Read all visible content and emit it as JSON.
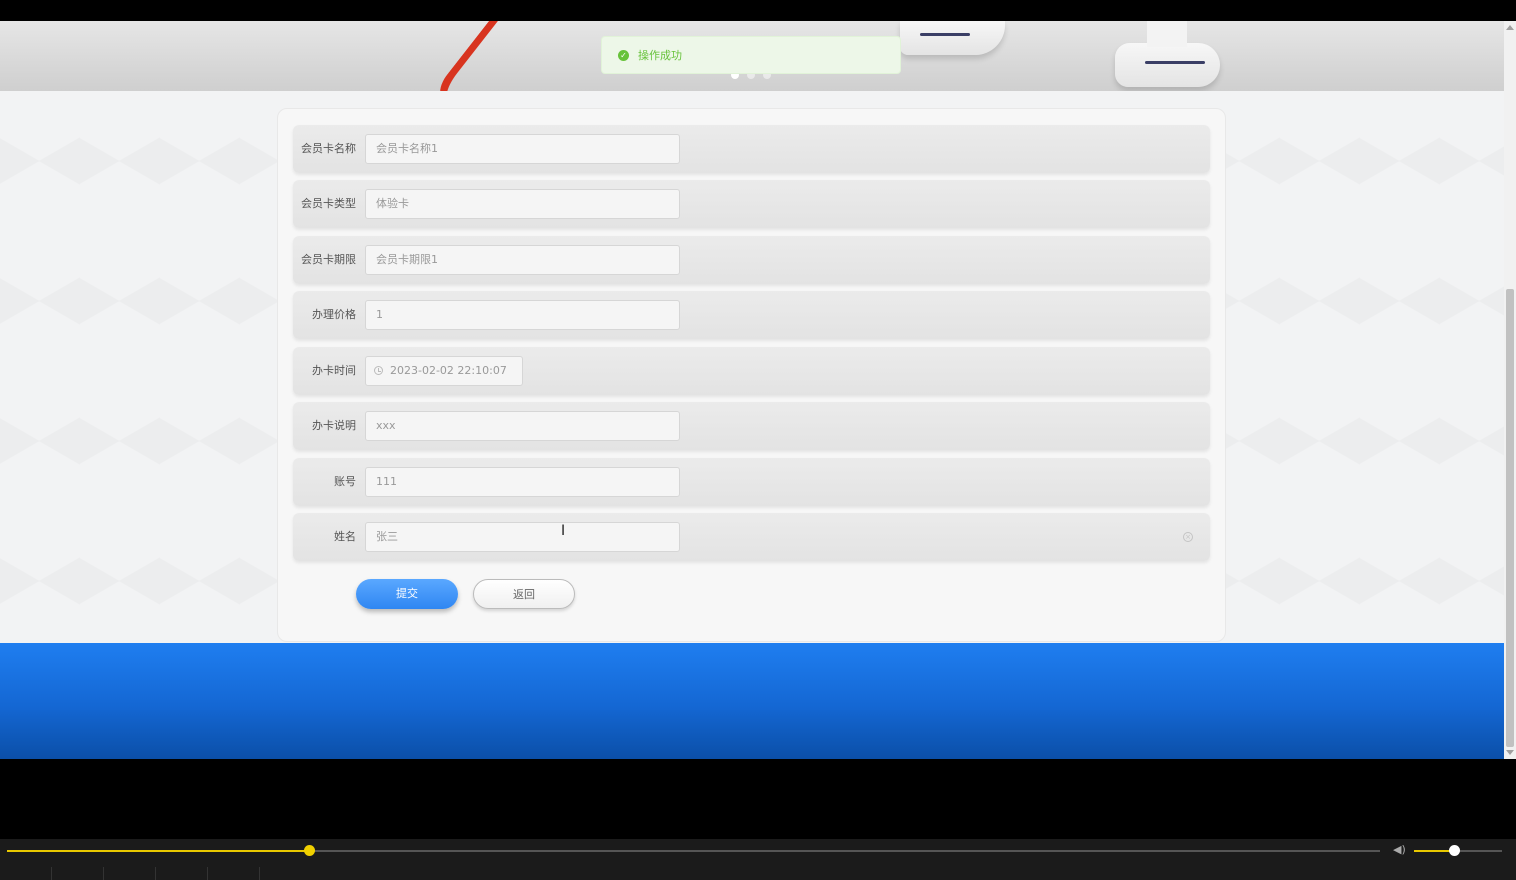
{
  "toast": {
    "message": "操作成功",
    "icon": "check-circle-icon",
    "color": "#67c23a"
  },
  "carousel": {
    "slides": 3,
    "active_index": 0
  },
  "form": {
    "fields": [
      {
        "label": "会员卡名称",
        "value": "会员卡名称1"
      },
      {
        "label": "会员卡类型",
        "value": "体验卡"
      },
      {
        "label": "会员卡期限",
        "value": "会员卡期限1"
      },
      {
        "label": "办理价格",
        "value": "1"
      },
      {
        "label": "办卡时间",
        "value": "2023-02-02 22:10:07"
      },
      {
        "label": "办卡说明",
        "value": "xxx"
      },
      {
        "label": "账号",
        "value": "111"
      },
      {
        "label": "姓名",
        "value": "张三"
      }
    ],
    "submit_label": "提交",
    "back_label": "返回"
  },
  "colors": {
    "primary": "#2f86f2",
    "footer": "#1467d3",
    "progress": "#e8c800"
  },
  "player": {
    "progress_fraction": 0.22,
    "volume_fraction": 0.45
  }
}
